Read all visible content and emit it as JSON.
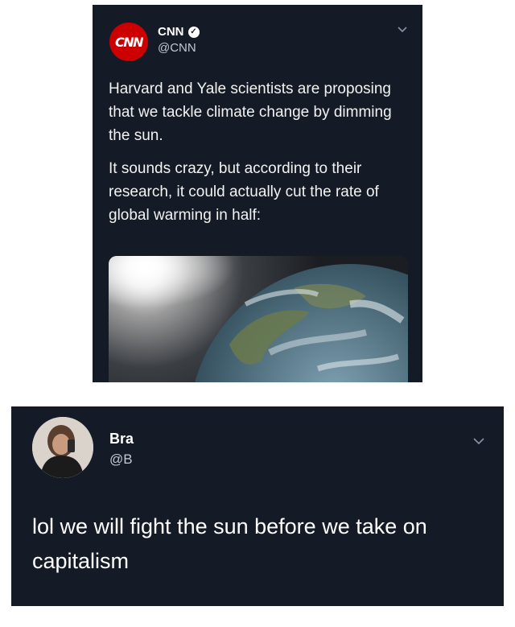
{
  "top_tweet": {
    "logo_text": "CNN",
    "display_name": "CNN",
    "handle": "@CNN",
    "paragraphs": [
      "Harvard and Yale scientists are proposing that we tackle climate change by dimming the sun.",
      "It sounds crazy, but according to their research, it could actually cut the rate of global warming in half:"
    ],
    "image_icon": "earth-from-space-image",
    "verified_icon": "verified-badge-icon",
    "menu_icon": "chevron-down-icon"
  },
  "reply_tweet": {
    "display_name": "Bra",
    "handle": "@B",
    "text": "lol we will fight the sun before we take on capitalism",
    "menu_icon": "chevron-down-icon"
  },
  "colors": {
    "tweet_background": "#151b26",
    "cnn_red": "#cc0000",
    "text_primary": "#ffffff",
    "text_secondary": "#c4c8d0"
  }
}
